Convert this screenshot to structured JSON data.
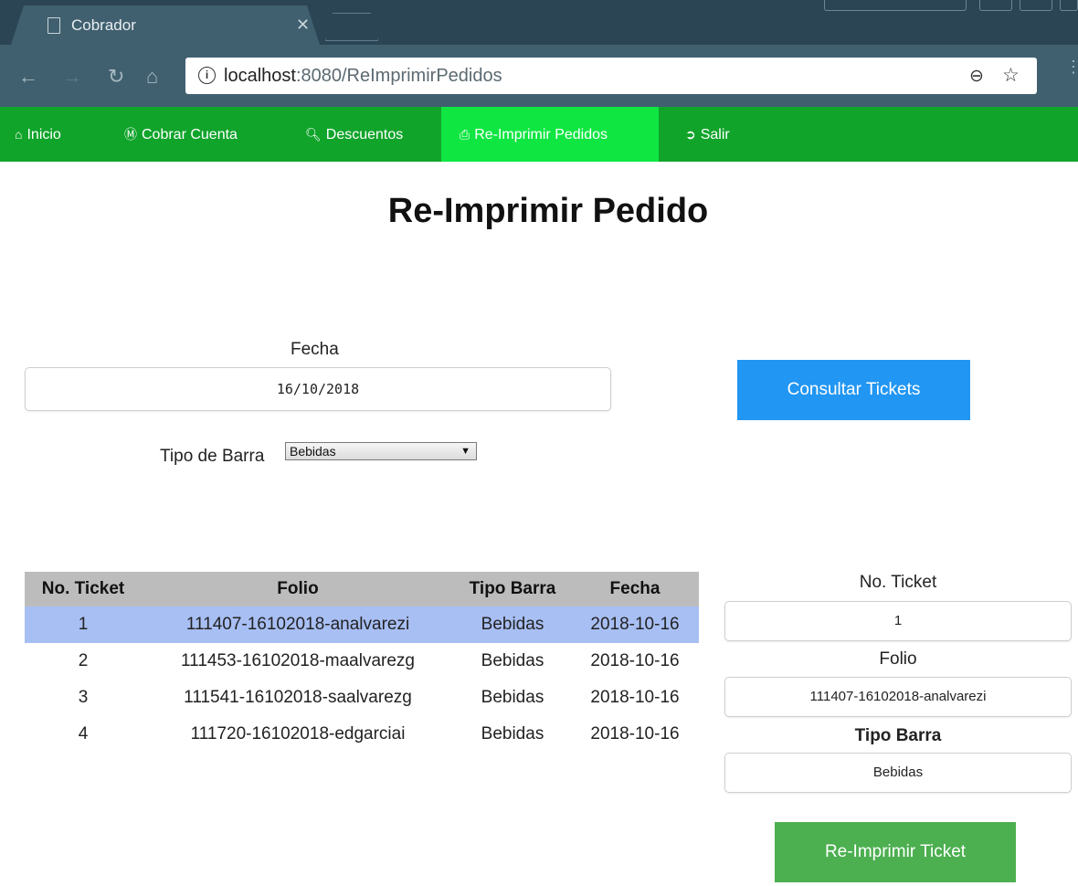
{
  "browser": {
    "tab_title": "Cobrador",
    "url_host": "localhost",
    "url_rest": ":8080/ReImprimirPedidos"
  },
  "nav": {
    "items": [
      {
        "label": "Inicio",
        "icon": "home-icon"
      },
      {
        "label": "Cobrar Cuenta",
        "icon": "dollar-circle-icon"
      },
      {
        "label": "Descuentos",
        "icon": "search-icon"
      },
      {
        "label": "Re-Imprimir Pedidos",
        "icon": "printer-icon",
        "active": true
      },
      {
        "label": "Salir",
        "icon": "sign-out-icon"
      }
    ],
    "colors": {
      "bar": "#11a42b",
      "active": "#0fe642"
    }
  },
  "page": {
    "title": "Re-Imprimir Pedido",
    "fecha_label": "Fecha",
    "fecha_value": "16/10/2018",
    "consultar_button": "Consultar Tickets",
    "tipo_barra_label": "Tipo de Barra",
    "tipo_barra_selected": "Bebidas"
  },
  "table": {
    "headers": [
      "No. Ticket",
      "Folio",
      "Tipo Barra",
      "Fecha"
    ],
    "rows": [
      [
        "1",
        "111407-16102018-analvarezi",
        "Bebidas",
        "2018-10-16"
      ],
      [
        "2",
        "111453-16102018-maalvarezg",
        "Bebidas",
        "2018-10-16"
      ],
      [
        "3",
        "111541-16102018-saalvarezg",
        "Bebidas",
        "2018-10-16"
      ],
      [
        "4",
        "111720-16102018-edgarciai",
        "Bebidas",
        "2018-10-16"
      ]
    ],
    "selected_row": 0
  },
  "detail": {
    "ticket_label": "No. Ticket",
    "ticket_value": "1",
    "folio_label": "Folio",
    "folio_value": "111407-16102018-analvarezi",
    "tipo_label": "Tipo Barra",
    "tipo_value": "Bebidas",
    "reprint_button": "Re-Imprimir Ticket"
  }
}
